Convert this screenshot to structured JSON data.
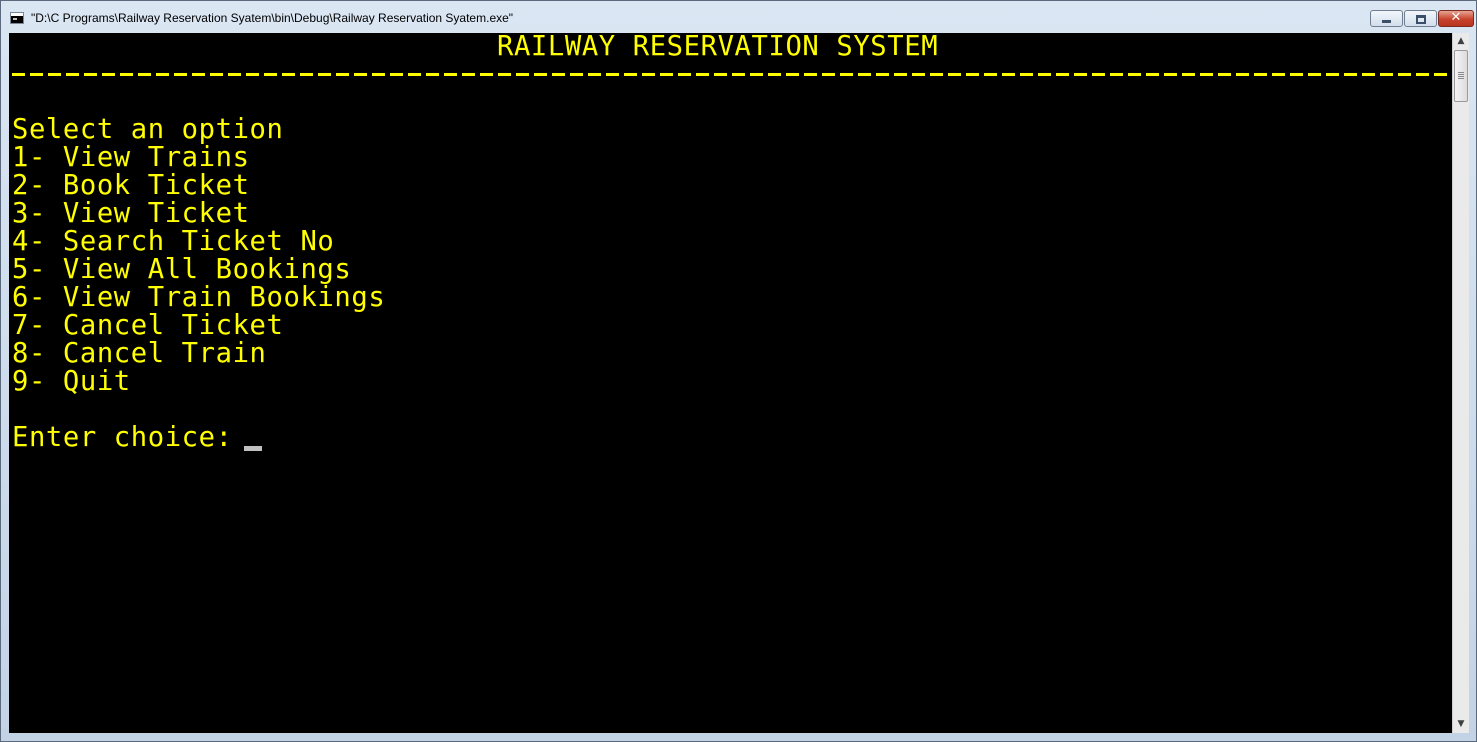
{
  "window": {
    "title": "\"D:\\C Programs\\Railway Reservation Syatem\\bin\\Debug\\Railway Reservation Syatem.exe\"",
    "close_glyph": "✕"
  },
  "console": {
    "header": "RAILWAY RESERVATION SYSTEM",
    "prompt_heading": "Select an option",
    "options": [
      "1- View Trains",
      "2- Book Ticket",
      "3- View Ticket",
      "4- Search Ticket No",
      "5- View All Bookings",
      "6- View Train Bookings",
      "7- Cancel Ticket",
      "8- Cancel Train",
      "9- Quit"
    ],
    "input_prompt": "Enter choice:",
    "text_color": "#ffff00",
    "background_color": "#000000"
  },
  "scrollbar": {
    "up_arrow": "▲",
    "down_arrow": "▼"
  }
}
